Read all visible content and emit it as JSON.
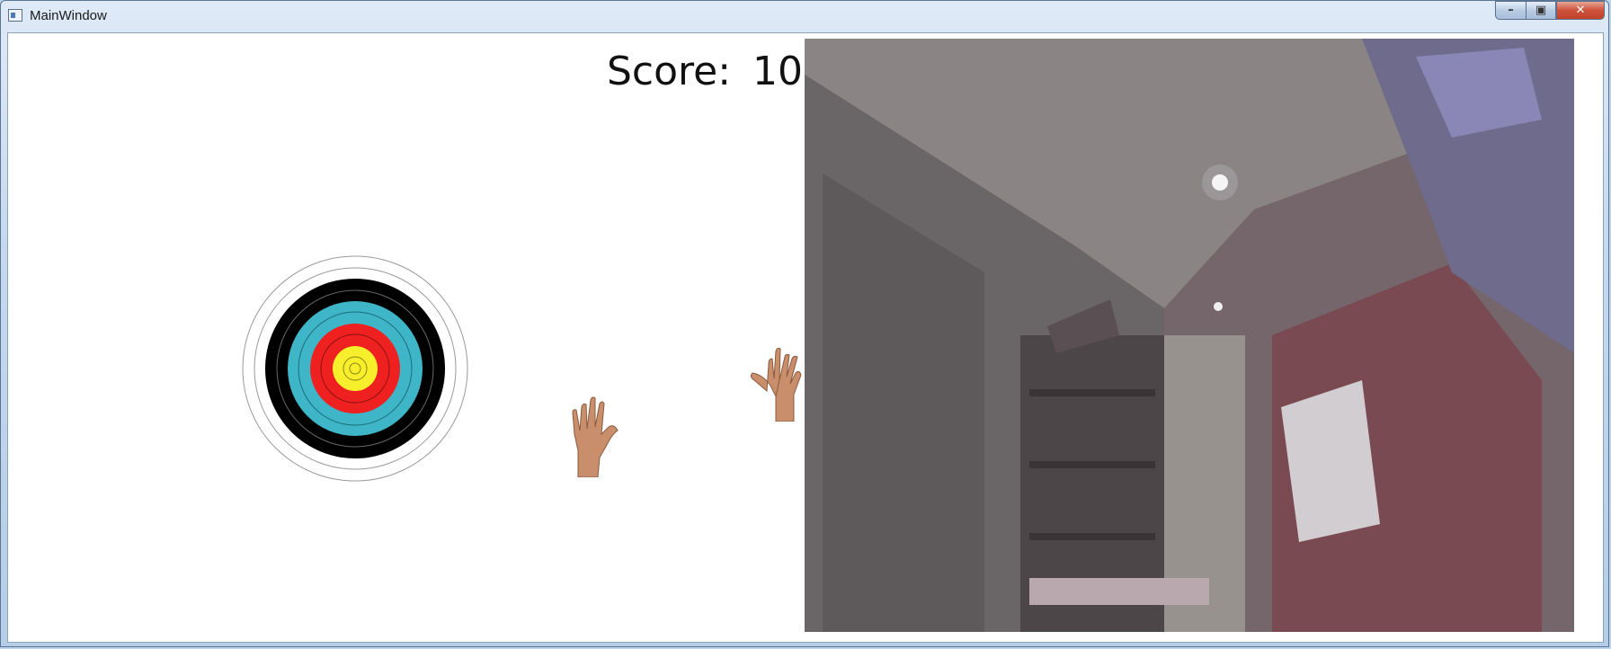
{
  "window": {
    "title": "MainWindow",
    "controls": {
      "minimize_icon": "minimize-icon",
      "maximize_icon": "maximize-icon",
      "close_icon": "close-icon"
    }
  },
  "game": {
    "score_label": "Score:",
    "score_value": "10",
    "target": "archery-target",
    "hands": [
      "left-hand-cursor",
      "right-hand-cursor"
    ],
    "camera_feed": "webcam-view"
  },
  "colors": {
    "target_white": "#ffffff",
    "target_black": "#000000",
    "target_blue": "#3fb5c8",
    "target_red": "#ee2020",
    "target_gold": "#f7ef2c"
  }
}
